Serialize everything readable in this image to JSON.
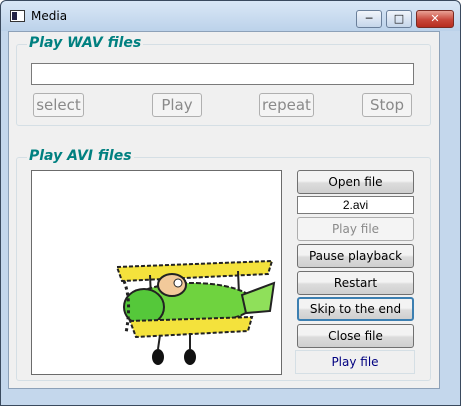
{
  "window": {
    "title": "Media"
  },
  "wav": {
    "group_label": "Play WAV files",
    "path_value": "",
    "buttons": {
      "select": "select",
      "play": "Play",
      "repeat": "repeat",
      "stop": "Stop"
    }
  },
  "avi": {
    "group_label": "Play AVI files",
    "file_name": "2.avi",
    "buttons": {
      "open": "Open file",
      "play": "Play file",
      "pause": "Pause playback",
      "restart": "Restart",
      "skip": "Skip to the end",
      "close": "Close file"
    },
    "status": "Play file"
  },
  "colors": {
    "group_label": "#008080",
    "status_text": "#000080"
  }
}
